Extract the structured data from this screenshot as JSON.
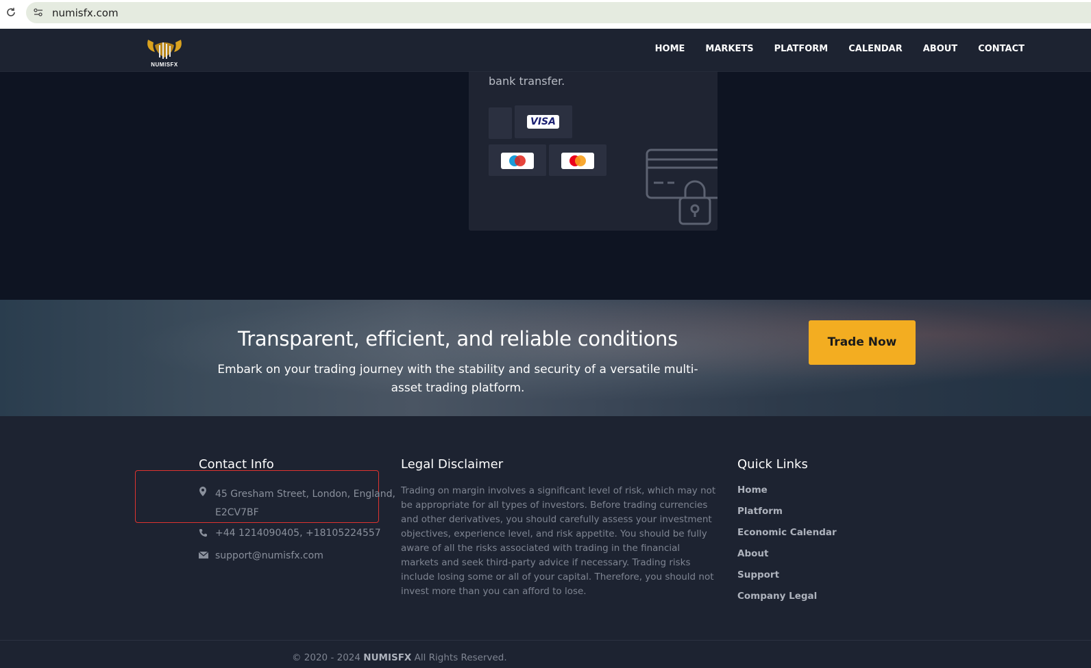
{
  "browser": {
    "url": "numisfx.com"
  },
  "navbar": {
    "logo_text": "NUMISFX",
    "items": [
      "HOME",
      "MARKETS",
      "PLATFORM",
      "CALENDAR",
      "ABOUT",
      "CONTACT"
    ]
  },
  "payment": {
    "text": "bank transfer.",
    "visa_label": "VISA",
    "methods": [
      "visa-icon",
      "maestro-icon",
      "mastercard-icon"
    ]
  },
  "banner": {
    "title": "Transparent, efficient, and reliable conditions",
    "subtitle": "Embark on your trading journey with the stability and security of a versatile multi-asset trading platform.",
    "cta": "Trade Now"
  },
  "footer": {
    "contact": {
      "title": "Contact Info",
      "address_line1": "45 Gresham Street, London, England,",
      "address_line2": "E2CV7BF",
      "phone": "+44 1214090405, +18105224557",
      "email": "support@numisfx.com"
    },
    "legal": {
      "title": "Legal Disclaimer",
      "text": "Trading on margin involves a significant level of risk, which may not be appropriate for all types of investors. Before trading currencies and other derivatives, you should carefully assess your investment objectives, experience level, and risk appetite. You should be fully aware of all the risks associated with trading in the financial markets and seek third-party advice if necessary. Trading risks include losing some or all of your capital. Therefore, you should not invest more than you can afford to lose."
    },
    "quick_links": {
      "title": "Quick Links",
      "items": [
        "Home",
        "Platform",
        "Economic Calendar",
        "About",
        "Support",
        "Company Legal"
      ]
    },
    "copyright": {
      "prefix": "© 2020 - 2024",
      "brand": "NUMISFX",
      "suffix": "All Rights Reserved."
    }
  },
  "colors": {
    "accent": "#f3ad21",
    "background": "#1d2331",
    "dark_section": "#0e1422",
    "highlight": "#e0342f"
  }
}
